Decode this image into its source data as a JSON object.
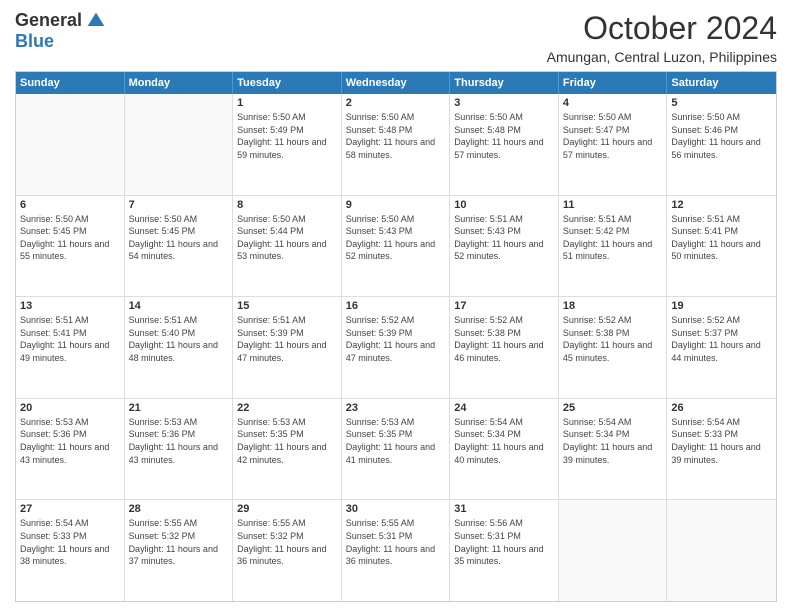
{
  "logo": {
    "general": "General",
    "blue": "Blue"
  },
  "title": "October 2024",
  "location": "Amungan, Central Luzon, Philippines",
  "headers": [
    "Sunday",
    "Monday",
    "Tuesday",
    "Wednesday",
    "Thursday",
    "Friday",
    "Saturday"
  ],
  "weeks": [
    [
      {
        "day": "",
        "empty": true
      },
      {
        "day": "",
        "empty": true
      },
      {
        "day": "1",
        "sunrise": "Sunrise: 5:50 AM",
        "sunset": "Sunset: 5:49 PM",
        "daylight": "Daylight: 11 hours and 59 minutes."
      },
      {
        "day": "2",
        "sunrise": "Sunrise: 5:50 AM",
        "sunset": "Sunset: 5:48 PM",
        "daylight": "Daylight: 11 hours and 58 minutes."
      },
      {
        "day": "3",
        "sunrise": "Sunrise: 5:50 AM",
        "sunset": "Sunset: 5:48 PM",
        "daylight": "Daylight: 11 hours and 57 minutes."
      },
      {
        "day": "4",
        "sunrise": "Sunrise: 5:50 AM",
        "sunset": "Sunset: 5:47 PM",
        "daylight": "Daylight: 11 hours and 57 minutes."
      },
      {
        "day": "5",
        "sunrise": "Sunrise: 5:50 AM",
        "sunset": "Sunset: 5:46 PM",
        "daylight": "Daylight: 11 hours and 56 minutes."
      }
    ],
    [
      {
        "day": "6",
        "sunrise": "Sunrise: 5:50 AM",
        "sunset": "Sunset: 5:45 PM",
        "daylight": "Daylight: 11 hours and 55 minutes."
      },
      {
        "day": "7",
        "sunrise": "Sunrise: 5:50 AM",
        "sunset": "Sunset: 5:45 PM",
        "daylight": "Daylight: 11 hours and 54 minutes."
      },
      {
        "day": "8",
        "sunrise": "Sunrise: 5:50 AM",
        "sunset": "Sunset: 5:44 PM",
        "daylight": "Daylight: 11 hours and 53 minutes."
      },
      {
        "day": "9",
        "sunrise": "Sunrise: 5:50 AM",
        "sunset": "Sunset: 5:43 PM",
        "daylight": "Daylight: 11 hours and 52 minutes."
      },
      {
        "day": "10",
        "sunrise": "Sunrise: 5:51 AM",
        "sunset": "Sunset: 5:43 PM",
        "daylight": "Daylight: 11 hours and 52 minutes."
      },
      {
        "day": "11",
        "sunrise": "Sunrise: 5:51 AM",
        "sunset": "Sunset: 5:42 PM",
        "daylight": "Daylight: 11 hours and 51 minutes."
      },
      {
        "day": "12",
        "sunrise": "Sunrise: 5:51 AM",
        "sunset": "Sunset: 5:41 PM",
        "daylight": "Daylight: 11 hours and 50 minutes."
      }
    ],
    [
      {
        "day": "13",
        "sunrise": "Sunrise: 5:51 AM",
        "sunset": "Sunset: 5:41 PM",
        "daylight": "Daylight: 11 hours and 49 minutes."
      },
      {
        "day": "14",
        "sunrise": "Sunrise: 5:51 AM",
        "sunset": "Sunset: 5:40 PM",
        "daylight": "Daylight: 11 hours and 48 minutes."
      },
      {
        "day": "15",
        "sunrise": "Sunrise: 5:51 AM",
        "sunset": "Sunset: 5:39 PM",
        "daylight": "Daylight: 11 hours and 47 minutes."
      },
      {
        "day": "16",
        "sunrise": "Sunrise: 5:52 AM",
        "sunset": "Sunset: 5:39 PM",
        "daylight": "Daylight: 11 hours and 47 minutes."
      },
      {
        "day": "17",
        "sunrise": "Sunrise: 5:52 AM",
        "sunset": "Sunset: 5:38 PM",
        "daylight": "Daylight: 11 hours and 46 minutes."
      },
      {
        "day": "18",
        "sunrise": "Sunrise: 5:52 AM",
        "sunset": "Sunset: 5:38 PM",
        "daylight": "Daylight: 11 hours and 45 minutes."
      },
      {
        "day": "19",
        "sunrise": "Sunrise: 5:52 AM",
        "sunset": "Sunset: 5:37 PM",
        "daylight": "Daylight: 11 hours and 44 minutes."
      }
    ],
    [
      {
        "day": "20",
        "sunrise": "Sunrise: 5:53 AM",
        "sunset": "Sunset: 5:36 PM",
        "daylight": "Daylight: 11 hours and 43 minutes."
      },
      {
        "day": "21",
        "sunrise": "Sunrise: 5:53 AM",
        "sunset": "Sunset: 5:36 PM",
        "daylight": "Daylight: 11 hours and 43 minutes."
      },
      {
        "day": "22",
        "sunrise": "Sunrise: 5:53 AM",
        "sunset": "Sunset: 5:35 PM",
        "daylight": "Daylight: 11 hours and 42 minutes."
      },
      {
        "day": "23",
        "sunrise": "Sunrise: 5:53 AM",
        "sunset": "Sunset: 5:35 PM",
        "daylight": "Daylight: 11 hours and 41 minutes."
      },
      {
        "day": "24",
        "sunrise": "Sunrise: 5:54 AM",
        "sunset": "Sunset: 5:34 PM",
        "daylight": "Daylight: 11 hours and 40 minutes."
      },
      {
        "day": "25",
        "sunrise": "Sunrise: 5:54 AM",
        "sunset": "Sunset: 5:34 PM",
        "daylight": "Daylight: 11 hours and 39 minutes."
      },
      {
        "day": "26",
        "sunrise": "Sunrise: 5:54 AM",
        "sunset": "Sunset: 5:33 PM",
        "daylight": "Daylight: 11 hours and 39 minutes."
      }
    ],
    [
      {
        "day": "27",
        "sunrise": "Sunrise: 5:54 AM",
        "sunset": "Sunset: 5:33 PM",
        "daylight": "Daylight: 11 hours and 38 minutes."
      },
      {
        "day": "28",
        "sunrise": "Sunrise: 5:55 AM",
        "sunset": "Sunset: 5:32 PM",
        "daylight": "Daylight: 11 hours and 37 minutes."
      },
      {
        "day": "29",
        "sunrise": "Sunrise: 5:55 AM",
        "sunset": "Sunset: 5:32 PM",
        "daylight": "Daylight: 11 hours and 36 minutes."
      },
      {
        "day": "30",
        "sunrise": "Sunrise: 5:55 AM",
        "sunset": "Sunset: 5:31 PM",
        "daylight": "Daylight: 11 hours and 36 minutes."
      },
      {
        "day": "31",
        "sunrise": "Sunrise: 5:56 AM",
        "sunset": "Sunset: 5:31 PM",
        "daylight": "Daylight: 11 hours and 35 minutes."
      },
      {
        "day": "",
        "empty": true
      },
      {
        "day": "",
        "empty": true
      }
    ]
  ]
}
